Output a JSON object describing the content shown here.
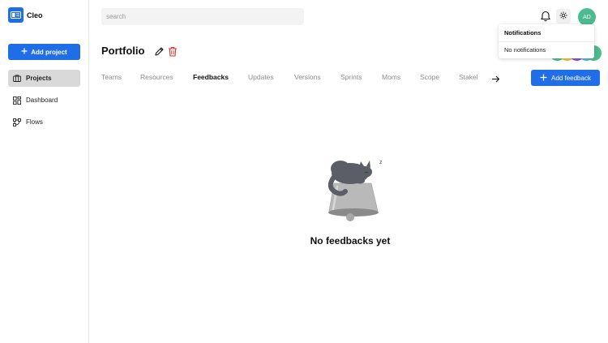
{
  "app": {
    "name": "Cleo"
  },
  "sidebar": {
    "add_project_label": "Add project",
    "items": [
      {
        "label": "Projects",
        "icon": "briefcase-icon",
        "active": true
      },
      {
        "label": "Dashboard",
        "icon": "dashboard-icon",
        "active": false
      },
      {
        "label": "Flows",
        "icon": "flow-icon",
        "active": false
      }
    ]
  },
  "search": {
    "placeholder": "search",
    "value": ""
  },
  "user": {
    "initials": "AD"
  },
  "notifications": {
    "title": "Notifications",
    "empty": "No notifications"
  },
  "page": {
    "title": "Portfolio"
  },
  "tabs": [
    "Teams",
    "Resources",
    "Feedbacks",
    "Updates",
    "Versions",
    "Sprints",
    "Moms",
    "Scope",
    "Stakel"
  ],
  "active_tab": "Feedbacks",
  "add_feedback_label": "Add feedback",
  "empty_state": {
    "message": "No feedbacks yet",
    "sleep_mark": "z"
  },
  "colors": {
    "accent": "#1f6ee8",
    "avatar": "#4dbb90",
    "delete": "#d9342b"
  }
}
